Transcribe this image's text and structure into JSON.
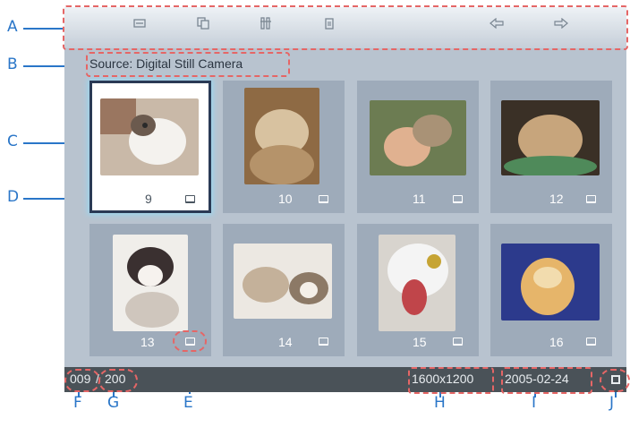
{
  "callouts": {
    "a": "A",
    "b": "B",
    "c": "C",
    "d": "D",
    "e": "E",
    "f": "F",
    "g": "G",
    "h": "H",
    "i": "I",
    "j": "J"
  },
  "toolbar": {
    "buttons": [
      "menu-icon",
      "copy-icon",
      "tools-icon",
      "delete-icon"
    ],
    "prev_icon": "arrow-left-icon",
    "next_icon": "arrow-right-icon"
  },
  "source_label": "Source: Digital Still Camera",
  "thumbnails": [
    {
      "number": "9",
      "selected": true
    },
    {
      "number": "10",
      "selected": false
    },
    {
      "number": "11",
      "selected": false
    },
    {
      "number": "12",
      "selected": false
    },
    {
      "number": "13",
      "selected": false
    },
    {
      "number": "14",
      "selected": false
    },
    {
      "number": "15",
      "selected": false
    },
    {
      "number": "16",
      "selected": false
    }
  ],
  "status": {
    "index": "009",
    "separator": "/",
    "total": "200",
    "resolution": "1600x1200",
    "date": "2005-02-24"
  },
  "colors": {
    "accent": "#2a76c8",
    "callout_box": "#e56666",
    "panel": "#b8c3cf",
    "status_bar": "#4a5258"
  }
}
